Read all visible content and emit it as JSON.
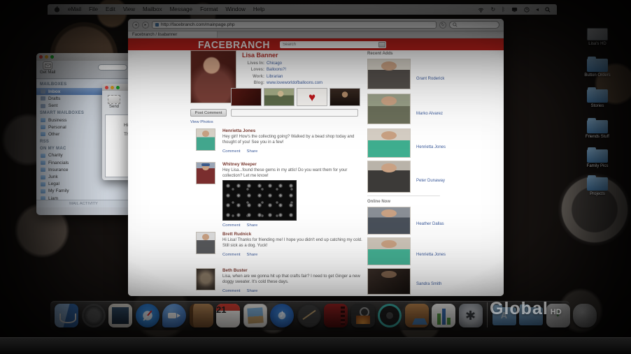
{
  "colors": {
    "brand_red": "#c2221c",
    "link_blue": "#3b5a9a",
    "selection_blue": "#6d92c4"
  },
  "menu_bar": {
    "items": [
      "eMail",
      "File",
      "Edit",
      "View",
      "Mailbox",
      "Message",
      "Format",
      "Window",
      "Help"
    ]
  },
  "mail_window": {
    "get_mail": "Get Mail",
    "mailboxes_title": "MAILBOXES",
    "mailboxes": [
      "Inbox",
      "Drafts",
      "Sent"
    ],
    "smart_title": "SMART MAILBOXES",
    "smart": [
      "Business",
      "Personal",
      "Other"
    ],
    "rss": "RSS",
    "on_my_mac_title": "ON MY MAC",
    "folders": [
      "Charity",
      "Financials",
      "Insurance",
      "Junk",
      "Legal",
      "My Family",
      "Liam"
    ],
    "activity": "MAIL ACTIVITY"
  },
  "compose_window": {
    "send_label": "Send",
    "line1": "Hi Beth,",
    "line2": "Thanks"
  },
  "browser": {
    "url": "http://facebranch.com/mainpage.php",
    "tab": "Facebranch / lisabanner",
    "page": {
      "logo": "FACEBRANCH",
      "search_placeholder": "Search",
      "profile": {
        "name": "Lisa Banner",
        "fields": [
          {
            "label": "Lives In:",
            "value": "Chicago"
          },
          {
            "label": "Loves:",
            "value": "Balloons?!"
          },
          {
            "label": "Work:",
            "value": "Librarian"
          },
          {
            "label": "Blog:",
            "value": "www.loveworldofballoons.com"
          }
        ]
      },
      "post_comment": "Post Comment",
      "view_photos": "View Photos",
      "feed": [
        {
          "name": "Henrietta Jones",
          "text": "Hey girl! How's the collecting going? Walked by a bead shop today and thought of you! See you in a few!",
          "actions": [
            "Comment",
            "Share"
          ]
        },
        {
          "name": "Whitney Weeper",
          "text": "Hey Lisa...found these gems in my attic! Do you want them for your collection? Let me know!",
          "actions": [
            "Comment",
            "Share"
          ]
        },
        {
          "name": "Brett Rudnick",
          "text": "Hi Lisa! Thanks for friending me! I hope you didn't end up catching my cold. Still sick as a dog. Yuck!",
          "actions": [
            "Comment",
            "Share"
          ]
        },
        {
          "name": "Beth Buster",
          "text": "Lisa, when are we gonna hit up that crafts fair? I need to get Ginger a new doggy sweater. It's cold these days.",
          "actions": [
            "Comment",
            "Share"
          ]
        }
      ],
      "sidebar": {
        "recent_adds_title": "Recent Adds",
        "recent_adds": [
          {
            "name": "Grant Roderick"
          },
          {
            "name": "Marko Alvarez"
          },
          {
            "name": "Henrietta Jones"
          },
          {
            "name": "Peter Dunaway"
          }
        ],
        "online_now_title": "Online Now",
        "online_now": [
          {
            "name": "Heather Dallas"
          },
          {
            "name": "Henrietta Jones"
          },
          {
            "name": "Sandra Smith"
          }
        ]
      }
    }
  },
  "desktop": {
    "icons": [
      {
        "label": "Lisa's HD"
      },
      {
        "label": "Button Orders"
      },
      {
        "label": "Stories"
      },
      {
        "label": "Friends Stuff"
      },
      {
        "label": "Family Pics"
      },
      {
        "label": "Projects"
      }
    ]
  },
  "dock": {
    "ical_date": "21",
    "icons": [
      "finder",
      "dashboard",
      "preview",
      "safari",
      "ichat",
      "address-book",
      "ical",
      "iphoto",
      "itunes",
      "garageband",
      "imovie",
      "photo-booth",
      "idvd",
      "keynote",
      "numbers",
      "system-preferences",
      "applications-folder",
      "documents-folder",
      "downloads",
      "trash"
    ]
  },
  "watermark": {
    "text": "Global",
    "hd": "HD"
  }
}
